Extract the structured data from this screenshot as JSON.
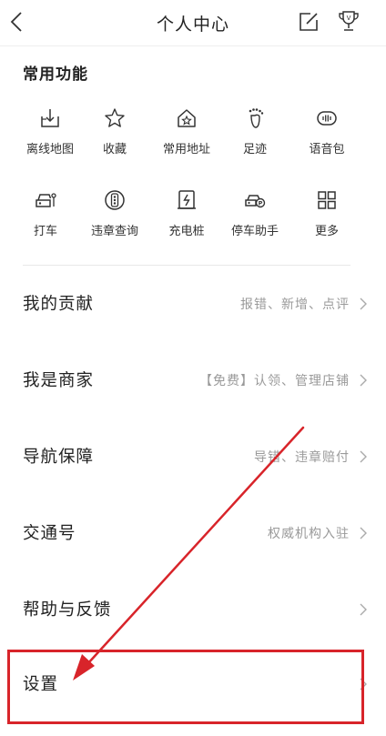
{
  "header": {
    "title": "个人中心",
    "back_icon": "chevron-left-icon",
    "edit_icon": "edit-icon",
    "trophy_icon": "trophy-icon"
  },
  "common": {
    "title": "常用功能",
    "items": [
      {
        "label": "离线地图",
        "icon": "offline-map-icon"
      },
      {
        "label": "收藏",
        "icon": "star-icon"
      },
      {
        "label": "常用地址",
        "icon": "home-star-icon"
      },
      {
        "label": "足迹",
        "icon": "footprint-icon"
      },
      {
        "label": "语音包",
        "icon": "voice-pack-icon"
      },
      {
        "label": "打车",
        "icon": "taxi-icon"
      },
      {
        "label": "违章查询",
        "icon": "violation-query-icon"
      },
      {
        "label": "充电桩",
        "icon": "charging-pile-icon"
      },
      {
        "label": "停车助手",
        "icon": "parking-car-icon"
      },
      {
        "label": "更多",
        "icon": "more-grid-icon"
      }
    ]
  },
  "menu": [
    {
      "title": "我的贡献",
      "sub": "报错、新增、点评"
    },
    {
      "title": "我是商家",
      "sub": "【免费】认领、管理店铺"
    },
    {
      "title": "导航保障",
      "sub": "导错、违章赔付"
    },
    {
      "title": "交通号",
      "sub": "权威机构入驻"
    },
    {
      "title": "帮助与反馈",
      "sub": ""
    },
    {
      "title": "设置",
      "sub": ""
    }
  ],
  "annotation": {
    "highlight_color": "#d8242a",
    "target": "设置"
  },
  "colors": {
    "text": "#222222",
    "subtext": "#9a9a9a",
    "annotation": "#d8242a"
  }
}
